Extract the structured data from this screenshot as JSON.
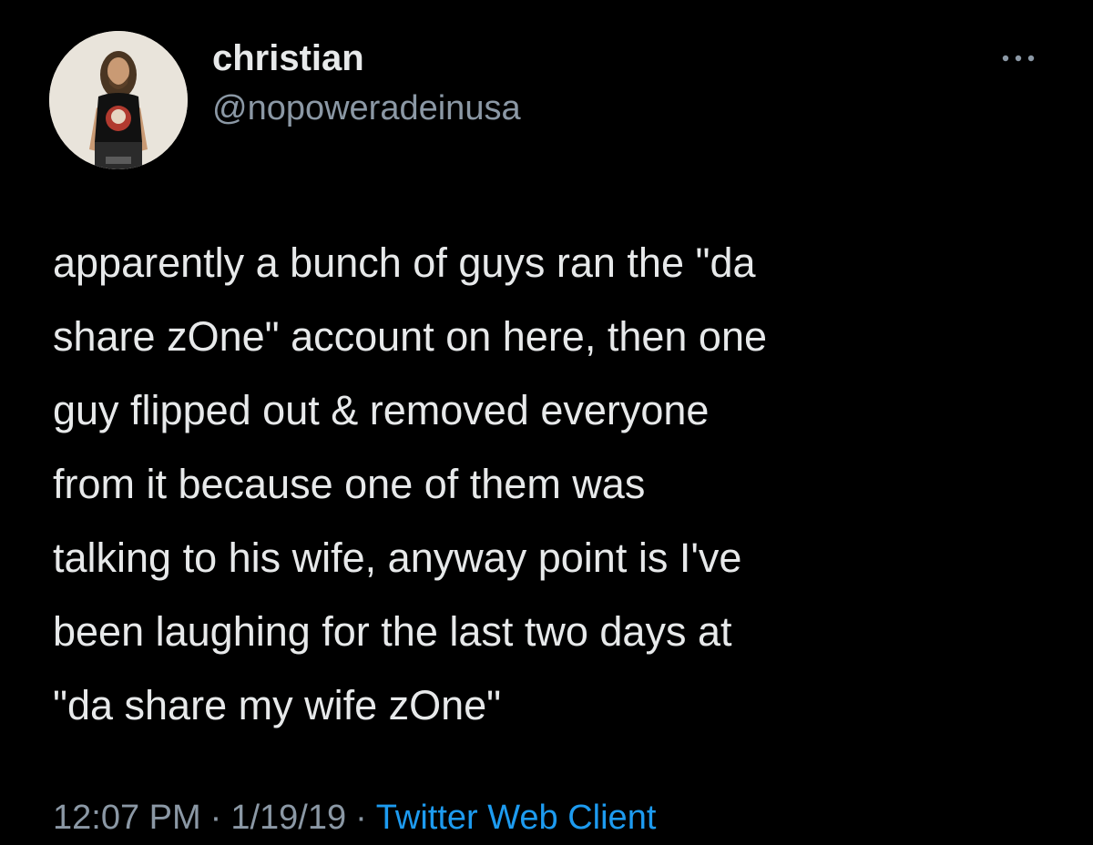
{
  "tweet": {
    "author": {
      "name": "christian",
      "handle": "@nopoweradeinusa"
    },
    "text": "apparently a bunch of guys ran the \"da\nshare zOne\" account on here, then one\nguy flipped out & removed everyone\nfrom it because one of them was\ntalking to his wife, anyway point is I've\nbeen laughing for the last two days at\n\"da share my wife zOne\"",
    "time": "12:07 PM",
    "date": "1/19/19",
    "separator": "·",
    "client": "Twitter Web Client"
  },
  "colors": {
    "background": "#000000",
    "primary_text": "#e7e9ea",
    "secondary_text": "#8b98a5",
    "link": "#1d9bf0"
  },
  "icons": {
    "more": "more-horizontal-icon"
  }
}
